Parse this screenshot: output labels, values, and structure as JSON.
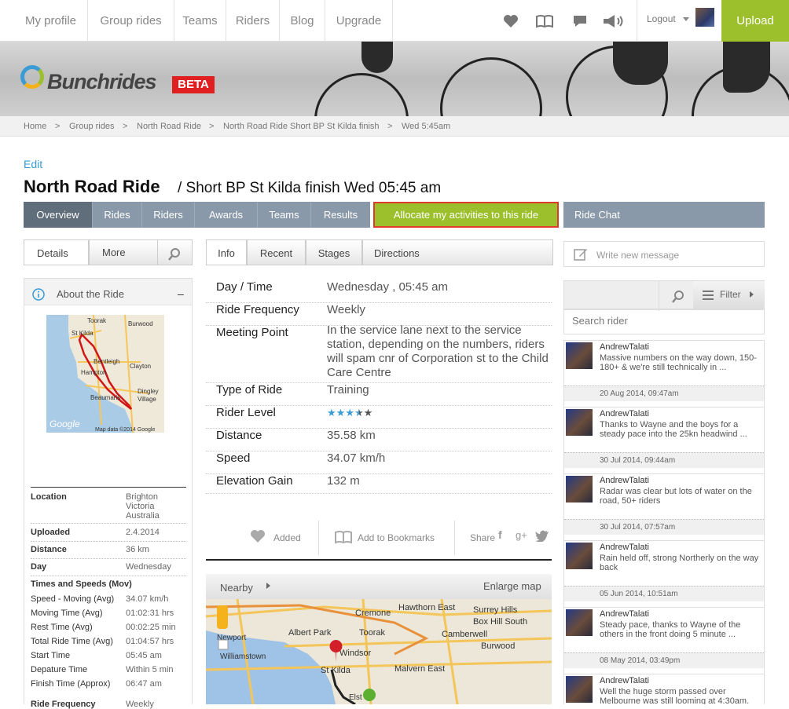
{
  "nav": {
    "items": [
      "My profile",
      "Group rides",
      "Teams",
      "Riders",
      "Blog",
      "Upgrade"
    ],
    "icons": [
      "heart-icon",
      "book-icon",
      "comment-icon",
      "megaphone-icon"
    ],
    "logout": "Logout",
    "upload": "Upload"
  },
  "brand": {
    "name": "Bunchrides",
    "badge": "BETA"
  },
  "breadcrumb": [
    "Home",
    "Group rides",
    "North Road Ride",
    "North Road Ride Short BP St Kilda finish",
    "Wed 5:45am"
  ],
  "page": {
    "edit": "Edit",
    "title": "North Road Ride",
    "subtitle": "/ Short BP St Kilda finish Wed 05:45 am"
  },
  "tabs": [
    "Overview",
    "Rides",
    "Riders",
    "Awards",
    "Teams",
    "Results"
  ],
  "allocate": "Allocate my activities to this ride",
  "ride_chat": "Ride Chat",
  "left": {
    "tabs": [
      "Details",
      "More"
    ],
    "about": "About the Ride",
    "collapse": "–",
    "map": {
      "labels": [
        "Toorak",
        "Burwood",
        "St Kilda",
        "Bentleigh",
        "Clayton",
        "Hampton",
        "Dingley Village",
        "Beaumaris"
      ],
      "google": "Google",
      "attrib": "Map data ©2014 Google"
    },
    "details": [
      {
        "k": "Location",
        "v": "Brighton\nVictoria\nAustralia"
      },
      {
        "k": "Uploaded",
        "v": "2.4.2014"
      },
      {
        "k": "Distance",
        "v": "36 km"
      },
      {
        "k": "Day",
        "v": "Wednesday"
      }
    ],
    "times_heading": "Times and Speeds (Mov)",
    "times": [
      {
        "k": "Speed - Moving (Avg)",
        "v": "34.07 km/h"
      },
      {
        "k": "Moving Time (Avg)",
        "v": "01:02:31 hrs"
      },
      {
        "k": "Rest Time (Avg)",
        "v": "00:02:25 min"
      },
      {
        "k": "Total Ride Time (Avg)",
        "v": "01:04:57 hrs"
      },
      {
        "k": "Start Time",
        "v": "05:45 am"
      },
      {
        "k": "Depature Time",
        "v": "Within 5 min"
      },
      {
        "k": "Finish Time (Approx)",
        "v": "06:47 am"
      }
    ],
    "cut_row": {
      "k": "Ride Frequency",
      "v": "Weekly"
    }
  },
  "center": {
    "tabs": [
      "Info",
      "Recent",
      "Stages",
      "Directions"
    ],
    "info": [
      {
        "k": "Day / Time",
        "v": "Wednesday , 05:45 am"
      },
      {
        "k": "Ride Frequency",
        "v": "Weekly"
      },
      {
        "k": "Meeting Point",
        "v": "In the service lane next to the service station, depending on the numbers, riders will spam cnr of Corporation st to the Child Care Centre"
      },
      {
        "k": "Type of Ride",
        "v": "Training"
      },
      {
        "k": "Rider Level",
        "v": ""
      },
      {
        "k": "Distance",
        "v": "35.58 km"
      },
      {
        "k": "Speed",
        "v": "34.07 km/h"
      },
      {
        "k": "Elevation Gain",
        "v": "132 m"
      }
    ],
    "rider_level_stars": 3.5,
    "actions": {
      "added": "Added",
      "bookmark": "Add to Bookmarks",
      "share": "Share"
    },
    "nearby": "Nearby",
    "enlarge": "Enlarge map",
    "bigmap_labels": [
      "Cremone",
      "Hawthorn East",
      "Surrey Hills",
      "Albert Park",
      "Toorak",
      "Box Hill South",
      "Newport",
      "Camberwell",
      "Burwood",
      "Williamstown",
      "Windsor",
      "St Kilda",
      "Malvern East",
      "Elst"
    ]
  },
  "chat": {
    "write": "Write new message",
    "filter": "Filter",
    "search_placeholder": "Search rider",
    "messages": [
      {
        "name": "AndrewTalati",
        "text": "Massive numbers on the way down, 150-180+ & we're still technically in ...",
        "date": "20 Aug 2014, 09:47am"
      },
      {
        "name": "AndrewTalati",
        "text": "Thanks to Wayne and the boys for a steady pace into the 25kn headwind ...",
        "date": "30 Jul 2014, 09:44am"
      },
      {
        "name": "AndrewTalati",
        "text": "Radar was clear but lots of water on the road, 50+ riders",
        "date": "30 Jul 2014, 07:57am"
      },
      {
        "name": "AndrewTalati",
        "text": "Rain held off, strong Northerly on the way back",
        "date": "05 Jun 2014, 10:51am"
      },
      {
        "name": "AndrewTalati",
        "text": "Steady pace, thanks to Wayne of the others in the front doing 5 minute ...",
        "date": "08 May 2014, 03:49pm"
      },
      {
        "name": "AndrewTalati",
        "text": "Well the huge storm passed over Melbourne was still looming at 4:30am.",
        "date": ""
      }
    ]
  },
  "colors": {
    "accent": "#9cbf2c",
    "tab": "#8a99a9",
    "tab_active": "#606d7a",
    "link": "#3a9bd5",
    "beta": "#e02020"
  }
}
